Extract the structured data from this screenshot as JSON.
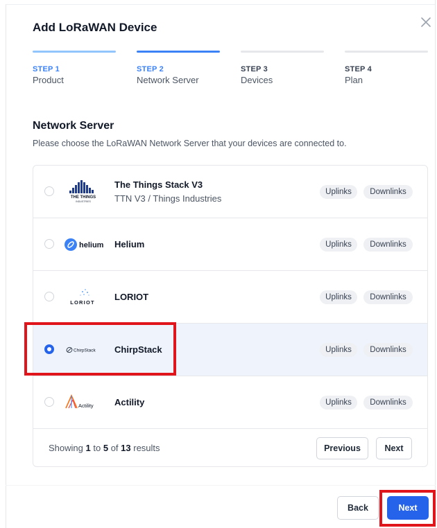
{
  "dialog": {
    "title": "Add LoRaWAN Device"
  },
  "steps": [
    {
      "number": "STEP 1",
      "name": "Product",
      "state": "complete"
    },
    {
      "number": "STEP 2",
      "name": "Network Server",
      "state": "current"
    },
    {
      "number": "STEP 3",
      "name": "Devices",
      "state": "pending"
    },
    {
      "number": "STEP 4",
      "name": "Plan",
      "state": "pending"
    }
  ],
  "section": {
    "title": "Network Server",
    "subtitle": "Please choose the LoRaWAN Network Server that your devices are connected to."
  },
  "servers": [
    {
      "name": "The Things Stack V3",
      "subtitle": "TTN V3 / Things Industries",
      "logo": "the-things-industries-logo",
      "logo_text": "THE THINGS",
      "logo_text2": "INDUSTRIES",
      "uplinks": "Uplinks",
      "downlinks": "Downlinks",
      "selected": false
    },
    {
      "name": "Helium",
      "subtitle": "",
      "logo": "helium-logo",
      "logo_text": "helium",
      "uplinks": "Uplinks",
      "downlinks": "Downlinks",
      "selected": false
    },
    {
      "name": "LORIOT",
      "subtitle": "",
      "logo": "loriot-logo",
      "logo_text": "LORIOT",
      "uplinks": "Uplinks",
      "downlinks": "Downlinks",
      "selected": false
    },
    {
      "name": "ChirpStack",
      "subtitle": "",
      "logo": "chirpstack-logo",
      "logo_text": "ChirpStack",
      "uplinks": "Uplinks",
      "downlinks": "Downlinks",
      "selected": true
    },
    {
      "name": "Actility",
      "subtitle": "",
      "logo": "actility-logo",
      "logo_text": "Actility",
      "uplinks": "Uplinks",
      "downlinks": "Downlinks",
      "selected": false
    }
  ],
  "pagination": {
    "prefix": "Showing",
    "from": "1",
    "to_word": "to",
    "to": "5",
    "of_word": "of",
    "total": "13",
    "suffix": "results",
    "previous_label": "Previous",
    "next_label": "Next"
  },
  "footer": {
    "back_label": "Back",
    "next_label": "Next"
  },
  "colors": {
    "accent": "#2563eb",
    "step_complete": "#93c5fd",
    "step_current": "#3b82f6",
    "step_pending": "#e5e7eb",
    "highlight": "#e0141b",
    "selected_row": "#eff4fc"
  }
}
